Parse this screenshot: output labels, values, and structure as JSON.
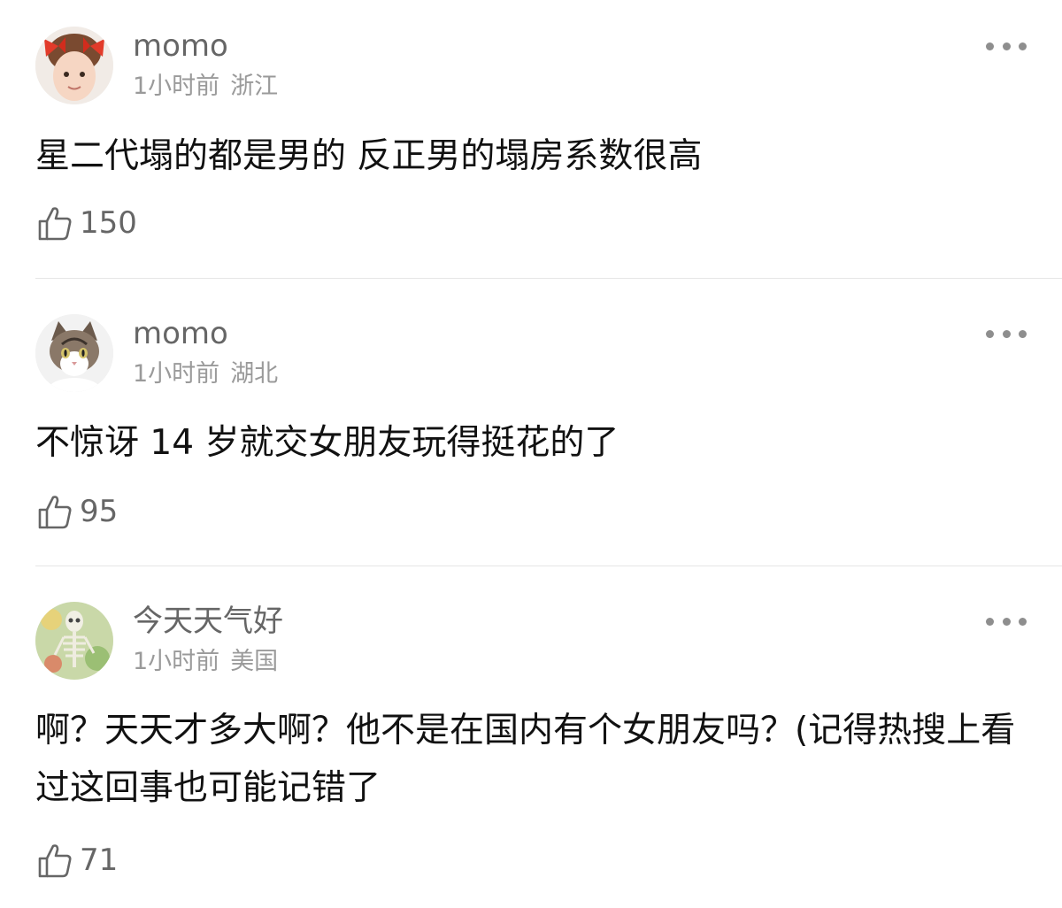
{
  "comments": [
    {
      "username": "momo",
      "time": "1小时前",
      "location": "浙江",
      "text": "星二代塌的都是男的 反正男的塌房系数很高",
      "likes": "150",
      "avatar_icon": "girl-with-red-bows-avatar"
    },
    {
      "username": "momo",
      "time": "1小时前",
      "location": "湖北",
      "text": "不惊讶 14 岁就交女朋友玩得挺花的了",
      "likes": "95",
      "avatar_icon": "cat-avatar"
    },
    {
      "username": "今天天气好",
      "time": "1小时前",
      "location": "美国",
      "text": "啊？天天才多大啊？他不是在国内有个女朋友吗？(记得热搜上看过这回事也可能记错了",
      "likes": "71",
      "avatar_icon": "skeleton-painting-avatar"
    }
  ],
  "icons": {
    "like": "thumbs-up-icon",
    "more": "more-options-icon"
  },
  "colors": {
    "text_primary": "#111111",
    "text_secondary": "#666666",
    "text_meta": "#9a9a9a",
    "divider": "#e6e6e6"
  }
}
